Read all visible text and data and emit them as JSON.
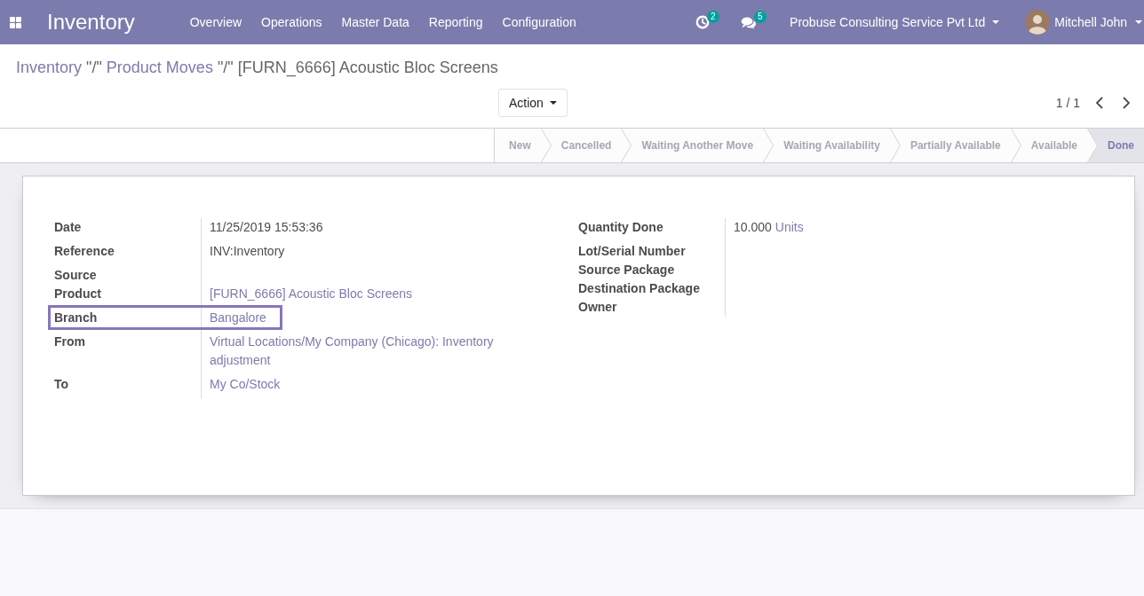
{
  "navbar": {
    "app_name": "Inventory",
    "menu": [
      "Overview",
      "Operations",
      "Master Data",
      "Reporting",
      "Configuration"
    ],
    "activity_count": "2",
    "message_count": "5",
    "company": "Probuse Consulting Service Pvt Ltd",
    "user": "Mitchell John"
  },
  "breadcrumb": [
    {
      "label": "Inventory",
      "kind": "link"
    },
    {
      "label": "\"/\"",
      "kind": "separator"
    },
    {
      "label": "Product Moves",
      "kind": "link"
    },
    {
      "label": "\"/\"",
      "kind": "separator"
    },
    {
      "label": "[FURN_6666] Acoustic Bloc Screens",
      "kind": "current"
    }
  ],
  "control_panel": {
    "action_button": "Action",
    "pager": "1 / 1"
  },
  "status_bar": [
    {
      "label": "New",
      "selected": false
    },
    {
      "label": "Cancelled",
      "selected": false
    },
    {
      "label": "Waiting Another Move",
      "selected": false
    },
    {
      "label": "Waiting Availability",
      "selected": false
    },
    {
      "label": "Partially Available",
      "selected": false
    },
    {
      "label": "Available",
      "selected": false
    },
    {
      "label": "Done",
      "selected": true
    }
  ],
  "form": {
    "left_group": [
      {
        "label": "Date",
        "kind": "text",
        "value": "11/25/2019 15:53:36",
        "highlighted": false
      },
      {
        "label": "Reference",
        "kind": "text",
        "value": "INV:Inventory",
        "highlighted": false
      },
      {
        "label": "Source",
        "kind": "empty",
        "highlighted": false
      },
      {
        "label": "Product",
        "kind": "link",
        "value": "[FURN_6666] Acoustic Bloc Screens",
        "highlighted": false
      },
      {
        "label": "Branch",
        "kind": "link",
        "value": "Bangalore",
        "highlighted": true
      },
      {
        "label": "From",
        "kind": "link",
        "value": "Virtual Locations/My Company (Chicago): Inventory adjustment",
        "highlighted": false
      },
      {
        "label": "To",
        "kind": "link",
        "value": "My Co/Stock",
        "highlighted": false
      }
    ],
    "right_group": [
      {
        "label": "Quantity Done",
        "kind": "quantity",
        "value": "10.000",
        "unit": "Units",
        "highlighted": false
      },
      {
        "label": "Lot/Serial Number",
        "kind": "empty",
        "highlighted": false
      },
      {
        "label": "Source Package",
        "kind": "empty",
        "highlighted": false
      },
      {
        "label": "Destination Package",
        "kind": "empty",
        "highlighted": false
      },
      {
        "label": "Owner",
        "kind": "empty",
        "highlighted": false
      }
    ]
  }
}
